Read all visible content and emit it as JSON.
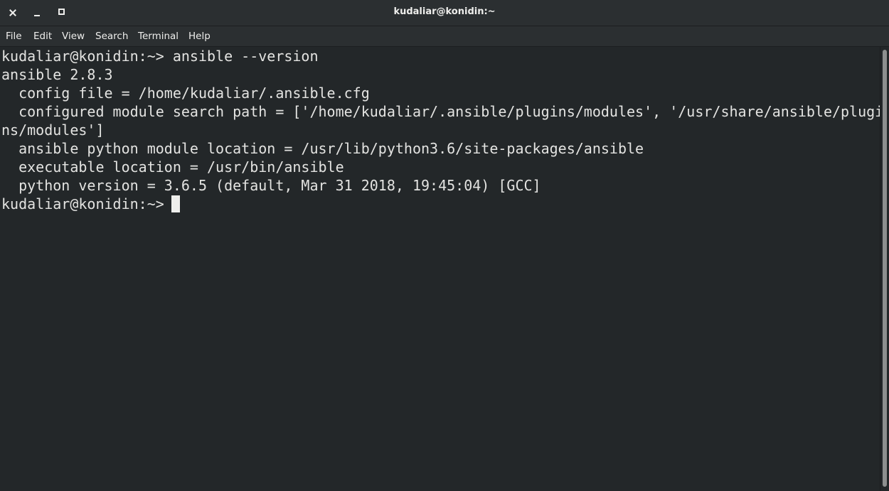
{
  "window": {
    "title": "kudaliar@konidin:~",
    "controls": {
      "close_icon": "close-icon",
      "minimize_icon": "minimize-icon",
      "maximize_icon": "maximize-icon"
    }
  },
  "menubar": {
    "items": [
      {
        "label": "File"
      },
      {
        "label": "Edit"
      },
      {
        "label": "View"
      },
      {
        "label": "Search"
      },
      {
        "label": "Terminal"
      },
      {
        "label": "Help"
      }
    ]
  },
  "terminal": {
    "lines": [
      "kudaliar@konidin:~> ansible --version",
      "ansible 2.8.3",
      "  config file = /home/kudaliar/.ansible.cfg",
      "  configured module search path = ['/home/kudaliar/.ansible/plugins/modules', '/usr/share/ansible/plugi",
      "ns/modules']",
      "  ansible python module location = /usr/lib/python3.6/site-packages/ansible",
      "  executable location = /usr/bin/ansible",
      "  python version = 3.6.5 (default, Mar 31 2018, 19:45:04) [GCC]",
      "kudaliar@konidin:~> "
    ]
  },
  "colors": {
    "background": "#232729",
    "chrome": "#2b2f31",
    "text": "#e3e3e1"
  }
}
